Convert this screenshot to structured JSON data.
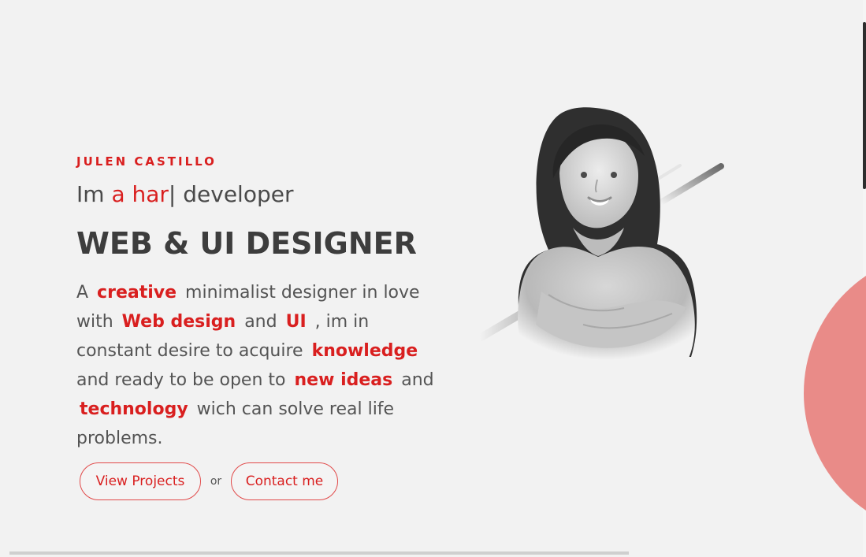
{
  "hero": {
    "name": "JULEN CASTILLO",
    "typed_prefix": "Im ",
    "typed_highlight": "a har",
    "typed_cursor": "|",
    "typed_suffix": " developer",
    "headline": "WEB & UI DESIGNER",
    "description": {
      "part1": "A ",
      "accent1": "creative",
      "part2": " minimalist designer in love with ",
      "accent2": "Web design",
      "part3": " and ",
      "accent3": "UI",
      "part4": " , im in constant desire to acquire ",
      "accent4": "knowledge",
      "part5": " and ready to be open to ",
      "accent5": "new ideas",
      "part6": " and ",
      "accent6": "technology",
      "part7": " wich can solve real life problems."
    },
    "buttons": {
      "projects": "View Projects",
      "or": "or",
      "contact": "Contact me"
    }
  },
  "icons": {
    "portrait": "portrait-image",
    "accent_circle": "decorative-circle"
  },
  "colors": {
    "accent": "#d91f1f",
    "decor": "#e98b88",
    "background": "#f2f2f2"
  }
}
